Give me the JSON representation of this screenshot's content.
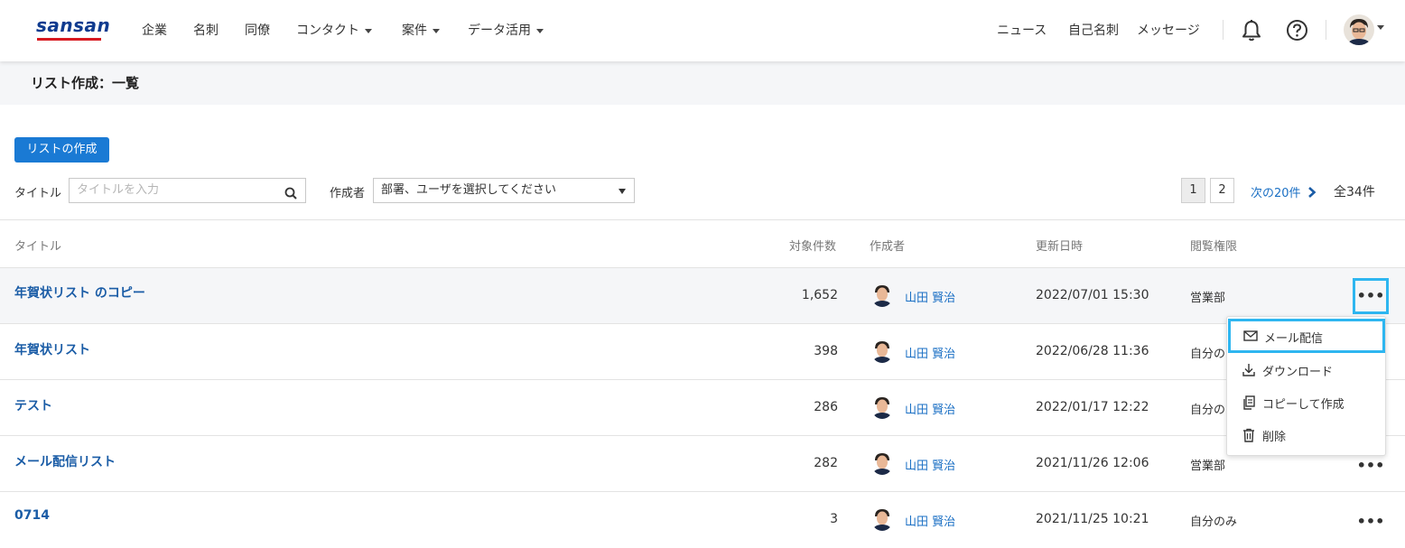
{
  "header": {
    "logo": "sansan",
    "nav": [
      {
        "label": "企業",
        "dropdown": false
      },
      {
        "label": "名刺",
        "dropdown": false
      },
      {
        "label": "同僚",
        "dropdown": false
      },
      {
        "label": "コンタクト",
        "dropdown": true
      },
      {
        "label": "案件",
        "dropdown": true
      },
      {
        "label": "データ活用",
        "dropdown": true
      }
    ],
    "right_links": [
      "ニュース",
      "自己名刺",
      "メッセージ"
    ],
    "icons": [
      "bell-icon",
      "help-icon"
    ]
  },
  "page": {
    "title": "リスト作成：一覧"
  },
  "toolbar": {
    "create_label": "リストの作成",
    "title_filter_label": "タイトル",
    "title_placeholder": "タイトルを入力",
    "creator_filter_label": "作成者",
    "creator_select_value": "部署、ユーザを選択してください"
  },
  "pagination": {
    "pages": [
      "1",
      "2"
    ],
    "current": "1",
    "next_label": "次の20件",
    "total_label": "全34件"
  },
  "table": {
    "columns": [
      "タイトル",
      "対象件数",
      "作成者",
      "更新日時",
      "閲覧権限"
    ],
    "rows": [
      {
        "title": "年賀状リスト のコピー",
        "count": "1,652",
        "creator": "山田 賢治",
        "updated": "2022/07/01 15:30",
        "permission": "営業部"
      },
      {
        "title": "年賀状リスト",
        "count": "398",
        "creator": "山田 賢治",
        "updated": "2022/06/28 11:36",
        "permission": "自分の"
      },
      {
        "title": "テスト",
        "count": "286",
        "creator": "山田 賢治",
        "updated": "2022/01/17 12:22",
        "permission": "自分の"
      },
      {
        "title": "メール配信リスト",
        "count": "282",
        "creator": "山田 賢治",
        "updated": "2021/11/26 12:06",
        "permission": "営業部"
      },
      {
        "title": "0714",
        "count": "3",
        "creator": "山田 賢治",
        "updated": "2021/11/25 10:21",
        "permission": "自分のみ"
      }
    ],
    "more_label": "•••"
  },
  "context_menu": {
    "items": [
      {
        "label": "メール配信",
        "icon": "mail-icon"
      },
      {
        "label": "ダウンロード",
        "icon": "download-icon"
      },
      {
        "label": "コピーして作成",
        "icon": "copy-icon"
      },
      {
        "label": "削除",
        "icon": "trash-icon"
      }
    ]
  },
  "colors": {
    "accent": "#1a7ad4",
    "link": "#1a5ca6",
    "highlight": "#2eb6f0",
    "logo_bar": "#d71920"
  }
}
